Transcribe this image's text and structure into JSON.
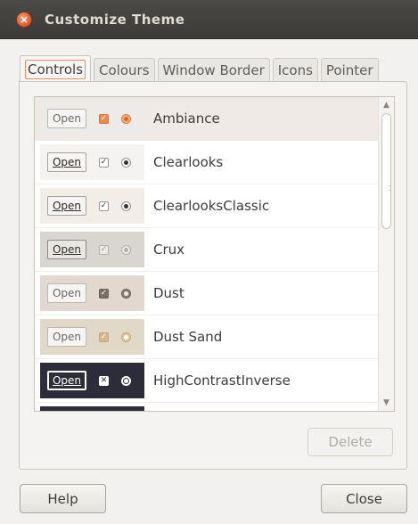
{
  "window": {
    "title": "Customize Theme",
    "close_glyph": "×"
  },
  "tabs": [
    {
      "label": "Controls",
      "active": true
    },
    {
      "label": "Colours",
      "active": false
    },
    {
      "label": "Window Border",
      "active": false
    },
    {
      "label": "Icons",
      "active": false
    },
    {
      "label": "Pointer",
      "active": false
    }
  ],
  "themes": [
    {
      "name": "Ambiance",
      "preview_button": "Open",
      "selected": true
    },
    {
      "name": "Clearlooks",
      "preview_button": "Open",
      "selected": false
    },
    {
      "name": "ClearlooksClassic",
      "preview_button": "Open",
      "selected": false
    },
    {
      "name": "Crux",
      "preview_button": "Open",
      "selected": false
    },
    {
      "name": "Dust",
      "preview_button": "Open",
      "selected": false
    },
    {
      "name": "Dust Sand",
      "preview_button": "Open",
      "selected": false
    },
    {
      "name": "HighContrastInverse",
      "preview_button": "Open",
      "selected": false
    }
  ],
  "buttons": {
    "delete": "Delete",
    "help": "Help",
    "close": "Close"
  },
  "scrollbar": {
    "up_glyph": "▲",
    "down_glyph": "▼"
  },
  "colors": {
    "accent": "#e58a5a",
    "titlebar": "#3c3b37",
    "selected_row": "#efeae6"
  }
}
